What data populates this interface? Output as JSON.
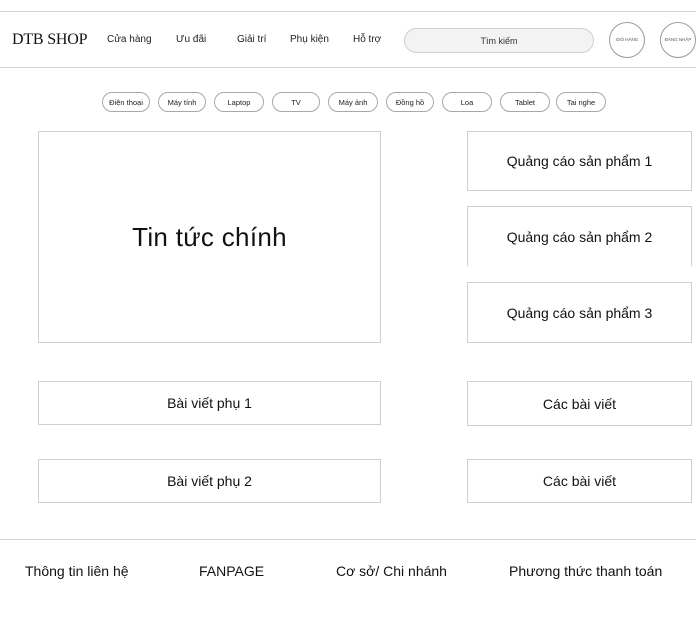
{
  "header": {
    "logo": "DTB SHOP",
    "nav": [
      "Cửa hàng",
      "Ưu đãi",
      "Giải trí",
      "Phụ kiện",
      "Hỗ trợ"
    ],
    "search_placeholder": "Tìm kiếm",
    "cart_label": "GIỎ HÀNG",
    "login_label": "ĐĂNG NHẬP"
  },
  "categories": [
    "Điện thoại",
    "Máy tính",
    "Laptop",
    "TV",
    "Máy ảnh",
    "Đồng hồ",
    "Loa",
    "Tablet",
    "Tai nghe"
  ],
  "main": {
    "headline": "Tin tức chính",
    "ads": [
      "Quảng cáo sản phẩm 1",
      "Quảng cáo sản phẩm 2",
      "Quảng cáo sản phẩm 3"
    ],
    "sub_articles": [
      "Bài viết phụ 1",
      "Bài viết phụ 2"
    ],
    "article_lists": [
      "Các bài viết",
      "Các bài viết"
    ]
  },
  "footer": {
    "links": [
      "Thông tin liên hệ",
      "FANPAGE",
      "Cơ sở/ Chi nhánh",
      "Phương thức thanh toán"
    ]
  }
}
